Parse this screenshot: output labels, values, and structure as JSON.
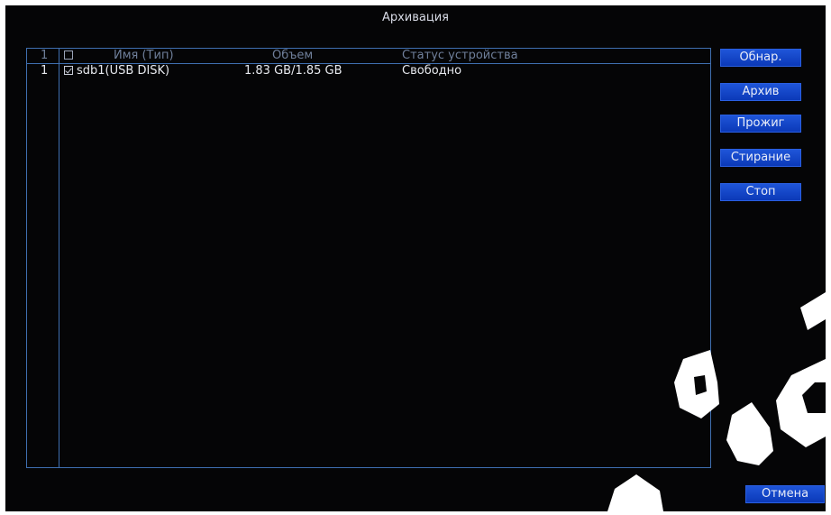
{
  "window": {
    "title": "Архивация"
  },
  "table": {
    "header": {
      "index": "1",
      "name": "Имя (Тип)",
      "volume": "Объем",
      "status": "Статус устройства"
    },
    "rows": [
      {
        "index": "1",
        "checked": true,
        "name": "sdb1(USB DISK)",
        "volume": "1.83 GB/1.85 GB",
        "status": "Свободно"
      }
    ]
  },
  "buttons": {
    "detect": "Обнар.",
    "archive": "Архив",
    "burn": "Прожиг",
    "erase": "Стирание",
    "stop": "Стоп",
    "cancel": "Отмена"
  },
  "colors": {
    "background": "#050506",
    "border": "#3f6fb0",
    "button": "#1448cc",
    "text": "#e7e9ee"
  }
}
